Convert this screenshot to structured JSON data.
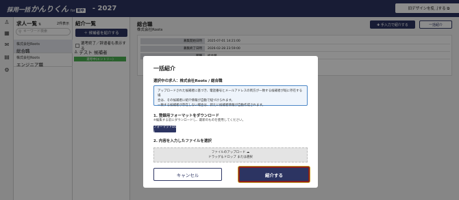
{
  "header": {
    "logo_main": "採用一括",
    "logo_brand": "かんりくん",
    "logo_for": "for",
    "logo_badge": "新卒",
    "year": "- 2027",
    "old_design_label": "旧デザインを使用する ⧉"
  },
  "job_list": {
    "title": "求人一覧",
    "count": "2件表示",
    "search_placeholder": "キーワード検索",
    "items": [
      {
        "company": "株式会社Roots",
        "title": "総合職"
      },
      {
        "company": "株式会社Roots",
        "title": "エンジニア職"
      }
    ]
  },
  "intro_list": {
    "title": "紹介一覧",
    "add_button": "＋ 候補者を紹介する",
    "show_closed": "選考終了／辞退者も表示する",
    "candidate_name": "テスト 候補者",
    "candidate_status": "選考中(エントリー)"
  },
  "main": {
    "title": "総合職",
    "company": "株式会社Roots",
    "manual_button": "✚ 手入力で紹介する",
    "bulk_button": "一括紹介",
    "info_rows": [
      {
        "key": "募集開始日時",
        "value": "2025-07-01 14:21:00"
      },
      {
        "key": "募集終了日時",
        "value": "2026-02-28 23:59:00"
      },
      {
        "key": "職種",
        "value": "総合職"
      }
    ]
  },
  "modal": {
    "title": "一括紹介",
    "selected_job": "選択中の求人：株式会社Roots / 総合職",
    "note_line1": "アップロードされた候補者に基づき、電話番号とメールアドレスの両方が一致する候補者が既に存在する場",
    "note_line2": "合は、その候補者に紹介情報が自動で紐づけられます。",
    "note_line3": "一致する候補者が存在しない場合は、新たに候補者情報が自動作成されます。",
    "step1_title": "1. 登録用フォーマットをダウンロード",
    "step1_note": "※編集する前にダウンロードし、最新のものを使用してください。",
    "format_button": "フォーマットDL ⤓",
    "step2_title": "2. 内容を入力したファイルを選択",
    "drop_line1": "ファイルのアップロード ☁",
    "drop_line2": "ドラッグ＆ドロップ または選択",
    "cancel_button": "キャンセル",
    "submit_button": "紹介する"
  }
}
